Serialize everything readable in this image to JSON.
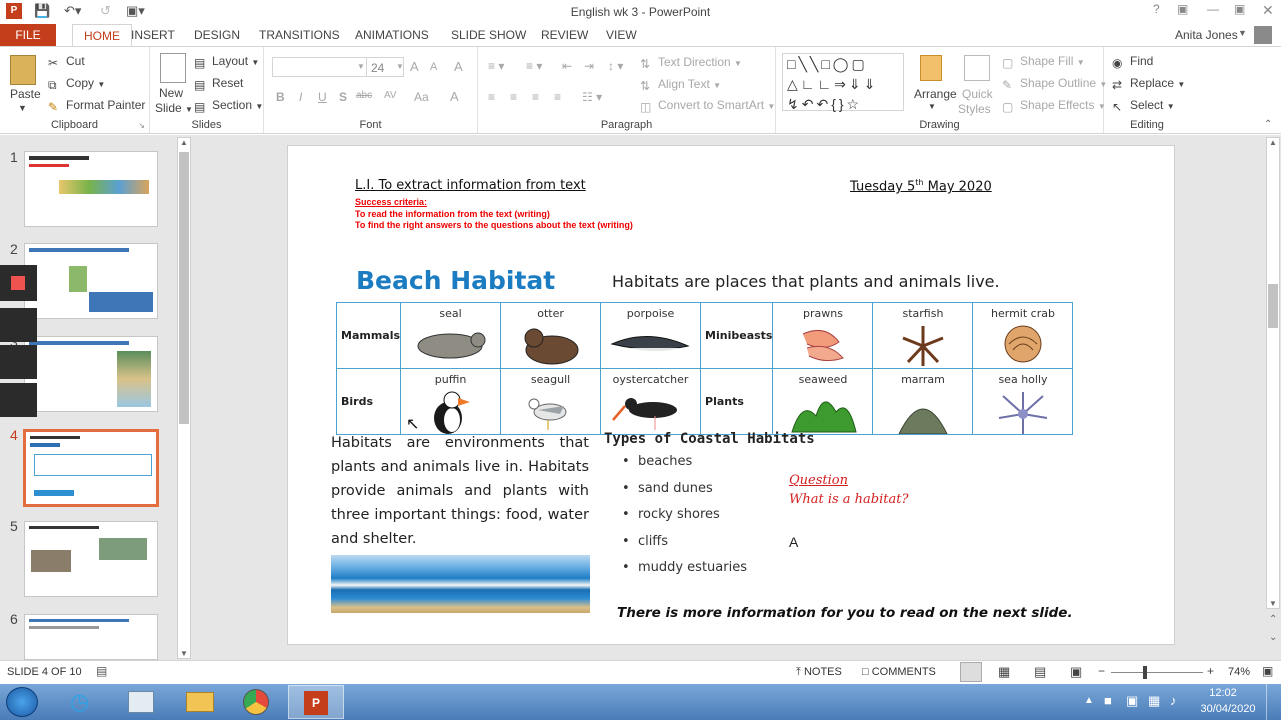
{
  "window": {
    "title": "English wk 3 - PowerPoint",
    "user": "Anita Jones",
    "help": "?"
  },
  "tabs": [
    "FILE",
    "HOME",
    "INSERT",
    "DESIGN",
    "TRANSITIONS",
    "ANIMATIONS",
    "SLIDE SHOW",
    "REVIEW",
    "VIEW"
  ],
  "ribbon": {
    "clipboard": {
      "paste": "Paste",
      "cut": "Cut",
      "copy": "Copy",
      "format_painter": "Format Painter",
      "label": "Clipboard"
    },
    "slides": {
      "new_slide_1": "New",
      "new_slide_2": "Slide",
      "layout": "Layout",
      "reset": "Reset",
      "section": "Section",
      "label": "Slides"
    },
    "font": {
      "size": "24",
      "label": "Font",
      "bold": "B",
      "italic": "I",
      "underline": "U",
      "strike": "S",
      "shadow": "abc",
      "spacing": "AV",
      "case": "Aa",
      "color": "A",
      "grow": "A",
      "shrink": "A",
      "clear": "A"
    },
    "paragraph": {
      "text_direction": "Text Direction",
      "align_text": "Align Text",
      "convert": "Convert to SmartArt",
      "label": "Paragraph"
    },
    "drawing": {
      "arrange": "Arrange",
      "quick_styles_1": "Quick",
      "quick_styles_2": "Styles",
      "shape_fill": "Shape Fill",
      "shape_outline": "Shape Outline",
      "shape_effects": "Shape Effects",
      "label": "Drawing"
    },
    "editing": {
      "find": "Find",
      "replace": "Replace",
      "select": "Select",
      "label": "Editing"
    }
  },
  "thumbnails": [
    "1",
    "2",
    "3",
    "4",
    "5",
    "6"
  ],
  "slide": {
    "li": "L.I. To extract information from text",
    "date_main": "Tuesday 5",
    "date_sup": "th",
    "date_rest": " May 2020",
    "success": "Success criteria:",
    "sc1": "To read the information from the text (writing)",
    "sc2": "To find the right answers to the questions about the text (writing)",
    "heading": "Beach Habitat",
    "subheading": "Habitats are places that plants and animals live.",
    "table": {
      "row1_head": "Mammals",
      "row1": [
        "seal",
        "otter",
        "porpoise"
      ],
      "row1_head2": "Minibeasts",
      "row1b": [
        "prawns",
        "starfish",
        "hermit crab"
      ],
      "row2_head": "Birds",
      "row2": [
        "puffin",
        "seagull",
        "oystercatcher"
      ],
      "row2_head2": "Plants",
      "row2b": [
        "seaweed",
        "marram",
        "sea holly"
      ]
    },
    "paragraph": "Habitats are environments that plants and animals live in. Habitats provide animals and plants with three important things: food, water and shelter.",
    "types_title": "Types of Coastal Habitats",
    "types": [
      "beaches",
      "sand dunes",
      "rocky shores",
      "cliffs",
      "muddy estuaries"
    ],
    "question_label": "Question",
    "question": "What is a habitat?",
    "answer": "A",
    "footer": "There is more information for you to read on the next slide."
  },
  "status": {
    "slide_of": "SLIDE 4 OF 10",
    "notes": "NOTES",
    "comments": "COMMENTS",
    "zoom": "74%"
  },
  "taskbar": {
    "time": "12:02",
    "date": "30/04/2020"
  }
}
